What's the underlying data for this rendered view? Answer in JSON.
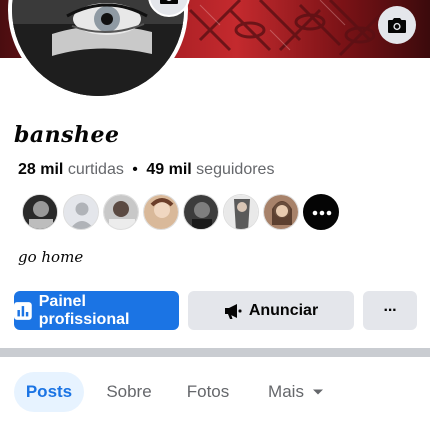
{
  "profile": {
    "name": "banshee",
    "likes_count": "28 mil",
    "likes_label": "curtidas",
    "separator": "•",
    "followers_count": "49 mil",
    "followers_label": "seguidores",
    "bio": "go home"
  },
  "actions": {
    "primary_label": "Painel profissional",
    "advertise_label": "Anunciar",
    "more_label": "···"
  },
  "tabs": [
    {
      "label": "Posts",
      "active": true
    },
    {
      "label": "Sobre",
      "active": false
    },
    {
      "label": "Fotos",
      "active": false
    },
    {
      "label": "Mais",
      "active": false
    }
  ],
  "icons": {
    "cover_camera": "camera-icon",
    "avatar_camera": "camera-icon",
    "dashboard": "bar-chart-icon",
    "advertise": "megaphone-icon",
    "more": "ellipsis-icon",
    "tab_more": "caret-down-icon"
  },
  "colors": {
    "accent": "#1b74e4",
    "button_gray": "#e4e6eb",
    "active_tab_bg": "#e7f3ff",
    "secondary_text": "#65676b"
  }
}
